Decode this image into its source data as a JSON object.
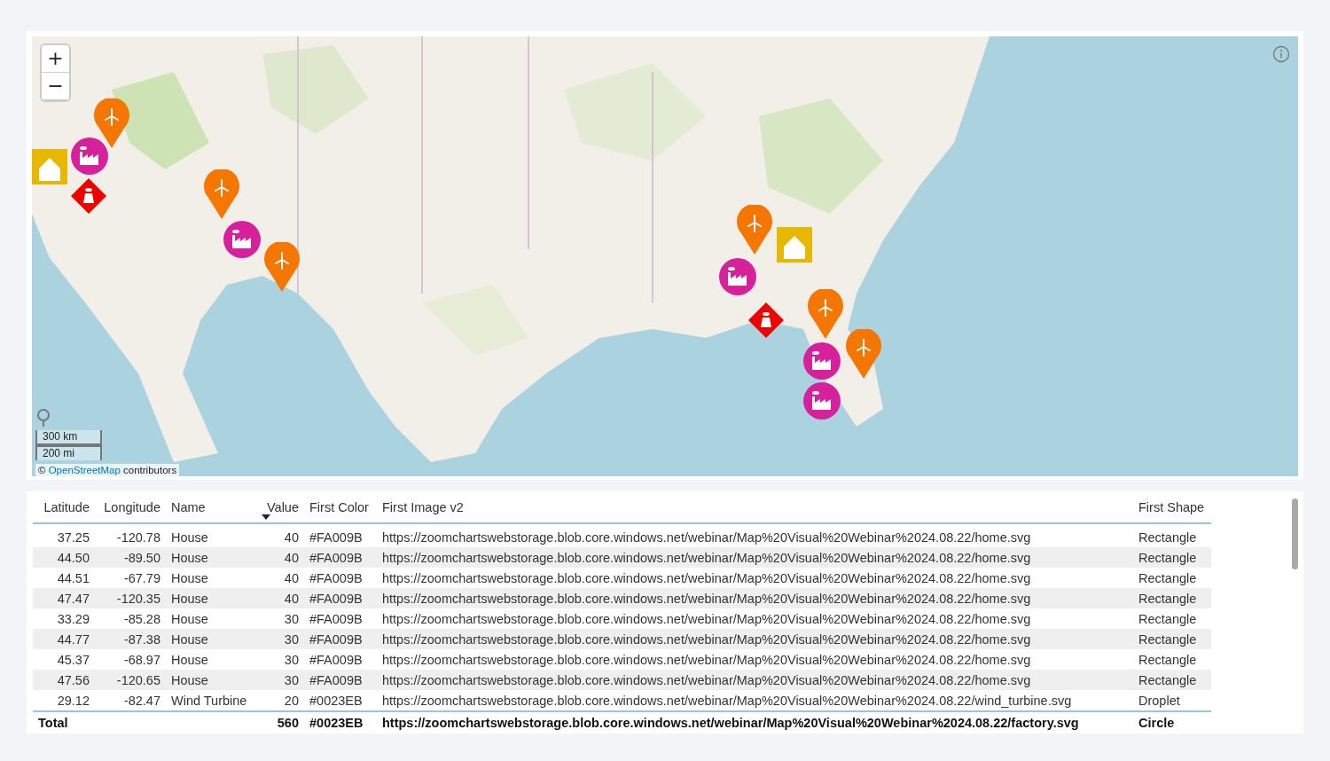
{
  "map": {
    "zoom_in": "+",
    "zoom_out": "−",
    "scale": [
      "300 km",
      "200 mi"
    ],
    "attribution": {
      "prefix": "©",
      "link": "OpenStreetMap",
      "suffix": "contributors"
    },
    "markers": [
      {
        "kind": "droplet",
        "color": "#f57600"
      },
      {
        "kind": "rectangle",
        "color": "#e8b800"
      },
      {
        "kind": "circle",
        "color": "#d6209c"
      },
      {
        "kind": "diamond",
        "color": "#f20000"
      },
      {
        "kind": "droplet",
        "color": "#f57600"
      },
      {
        "kind": "droplet",
        "color": "#f57600"
      },
      {
        "kind": "circle",
        "color": "#d6209c"
      },
      {
        "kind": "rectangle",
        "color": "#e8b800"
      },
      {
        "kind": "circle",
        "color": "#d6209c"
      },
      {
        "kind": "droplet",
        "color": "#f57600"
      },
      {
        "kind": "diamond",
        "color": "#f20000"
      },
      {
        "kind": "droplet",
        "color": "#f57600"
      },
      {
        "kind": "circle",
        "color": "#d6209c"
      },
      {
        "kind": "circle",
        "color": "#d6209c"
      },
      {
        "kind": "droplet",
        "color": "#f57600"
      }
    ]
  },
  "table": {
    "columns": [
      {
        "label": "Latitude",
        "sort_descending": false
      },
      {
        "label": "Longitude",
        "sort_descending": false
      },
      {
        "label": "Name",
        "sort_descending": false
      },
      {
        "label": "Value",
        "sort_descending": true
      },
      {
        "label": "First Color",
        "sort_descending": false
      },
      {
        "label": "First Image v2",
        "sort_descending": false
      },
      {
        "label": "First Shape",
        "sort_descending": false
      }
    ],
    "rows": [
      [
        "37.25",
        "-120.78",
        "House",
        "40",
        "#FA009B",
        "https://zoomchartswebstorage.blob.core.windows.net/webinar/Map%20Visual%20Webinar%2024.08.22/home.svg",
        "Rectangle"
      ],
      [
        "44.50",
        "-89.50",
        "House",
        "40",
        "#FA009B",
        "https://zoomchartswebstorage.blob.core.windows.net/webinar/Map%20Visual%20Webinar%2024.08.22/home.svg",
        "Rectangle"
      ],
      [
        "44.51",
        "-67.79",
        "House",
        "40",
        "#FA009B",
        "https://zoomchartswebstorage.blob.core.windows.net/webinar/Map%20Visual%20Webinar%2024.08.22/home.svg",
        "Rectangle"
      ],
      [
        "47.47",
        "-120.35",
        "House",
        "40",
        "#FA009B",
        "https://zoomchartswebstorage.blob.core.windows.net/webinar/Map%20Visual%20Webinar%2024.08.22/home.svg",
        "Rectangle"
      ],
      [
        "33.29",
        "-85.28",
        "House",
        "30",
        "#FA009B",
        "https://zoomchartswebstorage.blob.core.windows.net/webinar/Map%20Visual%20Webinar%2024.08.22/home.svg",
        "Rectangle"
      ],
      [
        "44.77",
        "-87.38",
        "House",
        "30",
        "#FA009B",
        "https://zoomchartswebstorage.blob.core.windows.net/webinar/Map%20Visual%20Webinar%2024.08.22/home.svg",
        "Rectangle"
      ],
      [
        "45.37",
        "-68.97",
        "House",
        "30",
        "#FA009B",
        "https://zoomchartswebstorage.blob.core.windows.net/webinar/Map%20Visual%20Webinar%2024.08.22/home.svg",
        "Rectangle"
      ],
      [
        "47.56",
        "-120.65",
        "House",
        "30",
        "#FA009B",
        "https://zoomchartswebstorage.blob.core.windows.net/webinar/Map%20Visual%20Webinar%2024.08.22/home.svg",
        "Rectangle"
      ],
      [
        "29.12",
        "-82.47",
        "Wind Turbine",
        "20",
        "#0023EB",
        "https://zoomchartswebstorage.blob.core.windows.net/webinar/Map%20Visual%20Webinar%2024.08.22/wind_turbine.svg",
        "Droplet"
      ]
    ],
    "total": {
      "label": "Total",
      "value": "560",
      "first_color": "#0023EB",
      "image": "https://zoomchartswebstorage.blob.core.windows.net/webinar/Map%20Visual%20Webinar%2024.08.22/factory.svg",
      "shape": "Circle"
    }
  }
}
